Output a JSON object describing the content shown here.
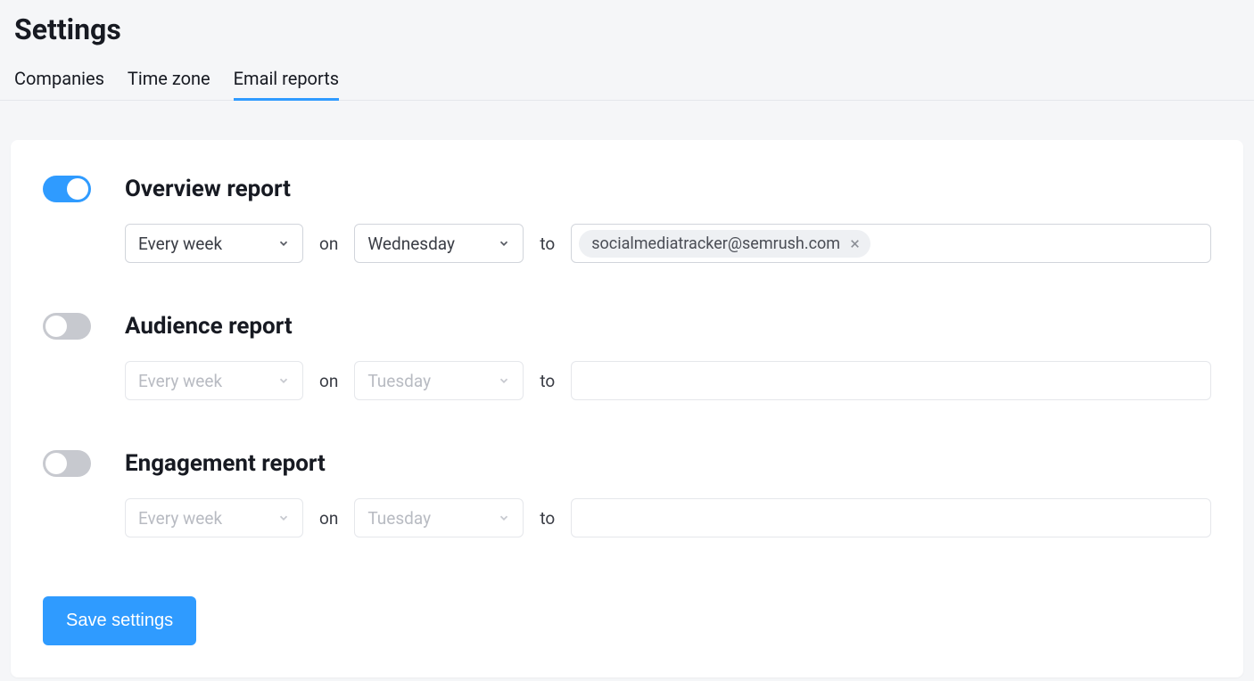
{
  "page": {
    "title": "Settings"
  },
  "tabs": [
    {
      "label": "Companies",
      "active": false
    },
    {
      "label": "Time zone",
      "active": false
    },
    {
      "label": "Email reports",
      "active": true
    }
  ],
  "labels": {
    "on": "on",
    "to": "to"
  },
  "reports": [
    {
      "title": "Overview report",
      "enabled": true,
      "frequency": "Every week",
      "day": "Wednesday",
      "emails": [
        "socialmediatracker@semrush.com"
      ]
    },
    {
      "title": "Audience report",
      "enabled": false,
      "frequency": "Every week",
      "day": "Tuesday",
      "emails": []
    },
    {
      "title": "Engagement report",
      "enabled": false,
      "frequency": "Every week",
      "day": "Tuesday",
      "emails": []
    }
  ],
  "actions": {
    "save": "Save settings"
  }
}
